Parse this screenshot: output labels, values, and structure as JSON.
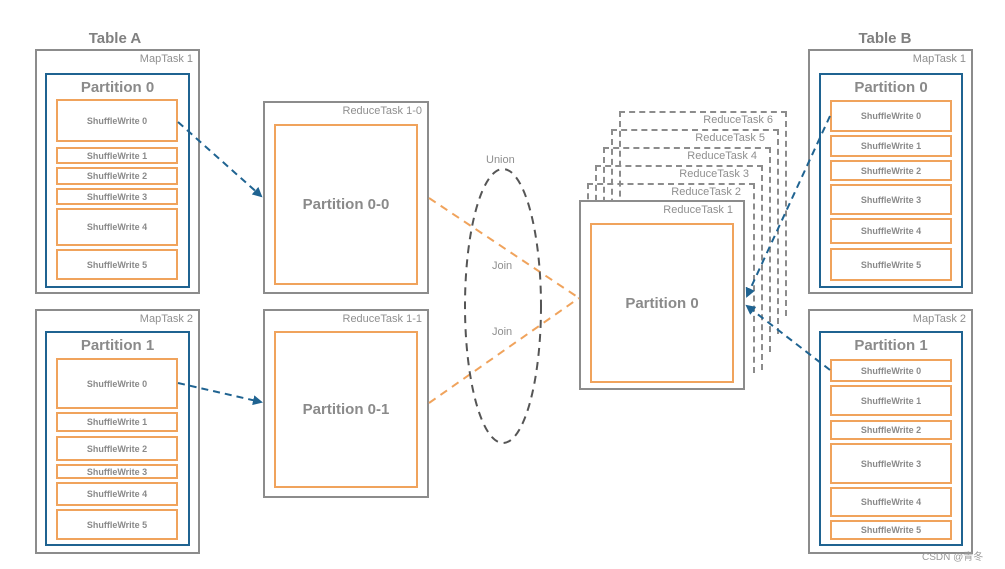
{
  "table_a": {
    "title": "Table A",
    "maptasks": [
      {
        "label": "MapTask 1",
        "partition": "Partition 0",
        "shuffle_writes": [
          "ShuffleWrite 0",
          "ShuffleWrite 1",
          "ShuffleWrite 2",
          "ShuffleWrite 3",
          "ShuffleWrite 4",
          "ShuffleWrite 5"
        ]
      },
      {
        "label": "MapTask 2",
        "partition": "Partition 1",
        "shuffle_writes": [
          "ShuffleWrite 0",
          "ShuffleWrite 1",
          "ShuffleWrite 2",
          "ShuffleWrite 3",
          "ShuffleWrite 4",
          "ShuffleWrite 5"
        ]
      }
    ]
  },
  "table_b": {
    "title": "Table B",
    "maptasks": [
      {
        "label": "MapTask 1",
        "partition": "Partition 0",
        "shuffle_writes": [
          "ShuffleWrite 0",
          "ShuffleWrite 1",
          "ShuffleWrite 2",
          "ShuffleWrite 3",
          "ShuffleWrite 4",
          "ShuffleWrite 5"
        ]
      },
      {
        "label": "MapTask 2",
        "partition": "Partition 1",
        "shuffle_writes": [
          "ShuffleWrite 0",
          "ShuffleWrite 1",
          "ShuffleWrite 2",
          "ShuffleWrite 3",
          "ShuffleWrite 4",
          "ShuffleWrite 5"
        ]
      }
    ]
  },
  "split_reduce_tasks": [
    {
      "label": "ReduceTask 1-0",
      "partition": "Partition 0-0"
    },
    {
      "label": "ReduceTask 1-1",
      "partition": "Partition 0-1"
    }
  ],
  "reduce_stack": {
    "main": {
      "label": "ReduceTask 1",
      "partition": "Partition 0"
    },
    "others": [
      "ReduceTask 2",
      "ReduceTask 3",
      "ReduceTask 4",
      "ReduceTask 5",
      "ReduceTask 6"
    ]
  },
  "union": {
    "label": "Union",
    "joins": [
      "Join",
      "Join"
    ]
  },
  "colors": {
    "map_border": "#8c8c8c",
    "partition_border": "#1f6391",
    "shuffle_border": "#f0a35c",
    "arrow_blue": "#1f6391",
    "join_orange": "#f0a35c",
    "union_gray": "#555555"
  },
  "watermark": "CSDN @青冬"
}
